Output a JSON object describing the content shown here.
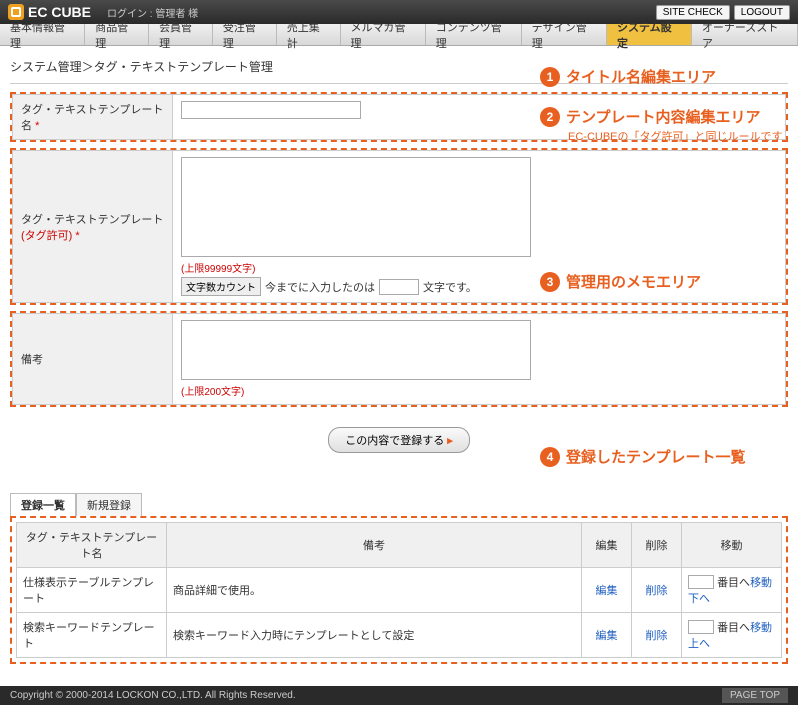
{
  "header": {
    "logo": "EC CUBE",
    "login_label": "ログイン : 管理者 様",
    "site_check": "SITE CHECK",
    "logout": "LOGOUT"
  },
  "nav": [
    "基本情報管理",
    "商品管理",
    "会員管理",
    "受注管理",
    "売上集計",
    "メルマガ管理",
    "コンテンツ管理",
    "デザイン管理",
    "システム設定",
    "オーナーズストア"
  ],
  "nav_active_index": 8,
  "breadcrumb": "システム管理＞タグ・テキストテンプレート管理",
  "form": {
    "name_label": "タグ・テキストテンプレート名",
    "body_label": "タグ・テキストテンプレート",
    "tag_allow": "(タグ許可)",
    "memo_label": "備考",
    "required_mark": "*",
    "body_limit": "(上限99999文字)",
    "memo_limit": "(上限200文字)",
    "count_btn": "文字数カウント",
    "count_text_before": "今までに入力したのは",
    "count_text_after": "文字です。",
    "submit": "この内容で登録する"
  },
  "annotations": {
    "a1": "タイトル名編集エリア",
    "a2": "テンプレート内容編集エリア",
    "a2_sub": "EC-CUBEの「タグ許可」と同じルールです",
    "a3": "管理用のメモエリア",
    "a4": "登録したテンプレート一覧"
  },
  "list": {
    "tab_list": "登録一覧",
    "tab_new": "新規登録",
    "cols": {
      "name": "タグ・テキストテンプレート名",
      "memo": "備考",
      "edit": "編集",
      "delete": "削除",
      "move": "移動"
    },
    "edit_label": "編集",
    "delete_label": "削除",
    "move_suffix": "番目へ",
    "move_link": "移動",
    "move_down": "下へ",
    "move_up": "上へ",
    "rows": [
      {
        "name": "仕様表示テーブルテンプレート",
        "memo": "商品詳細で使用。"
      },
      {
        "name": "検索キーワードテンプレート",
        "memo": "検索キーワード入力時にテンプレートとして設定"
      }
    ]
  },
  "footer": {
    "copyright": "Copyright © 2000-2014 LOCKON CO.,LTD. All Rights Reserved.",
    "pagetop": "PAGE TOP"
  }
}
